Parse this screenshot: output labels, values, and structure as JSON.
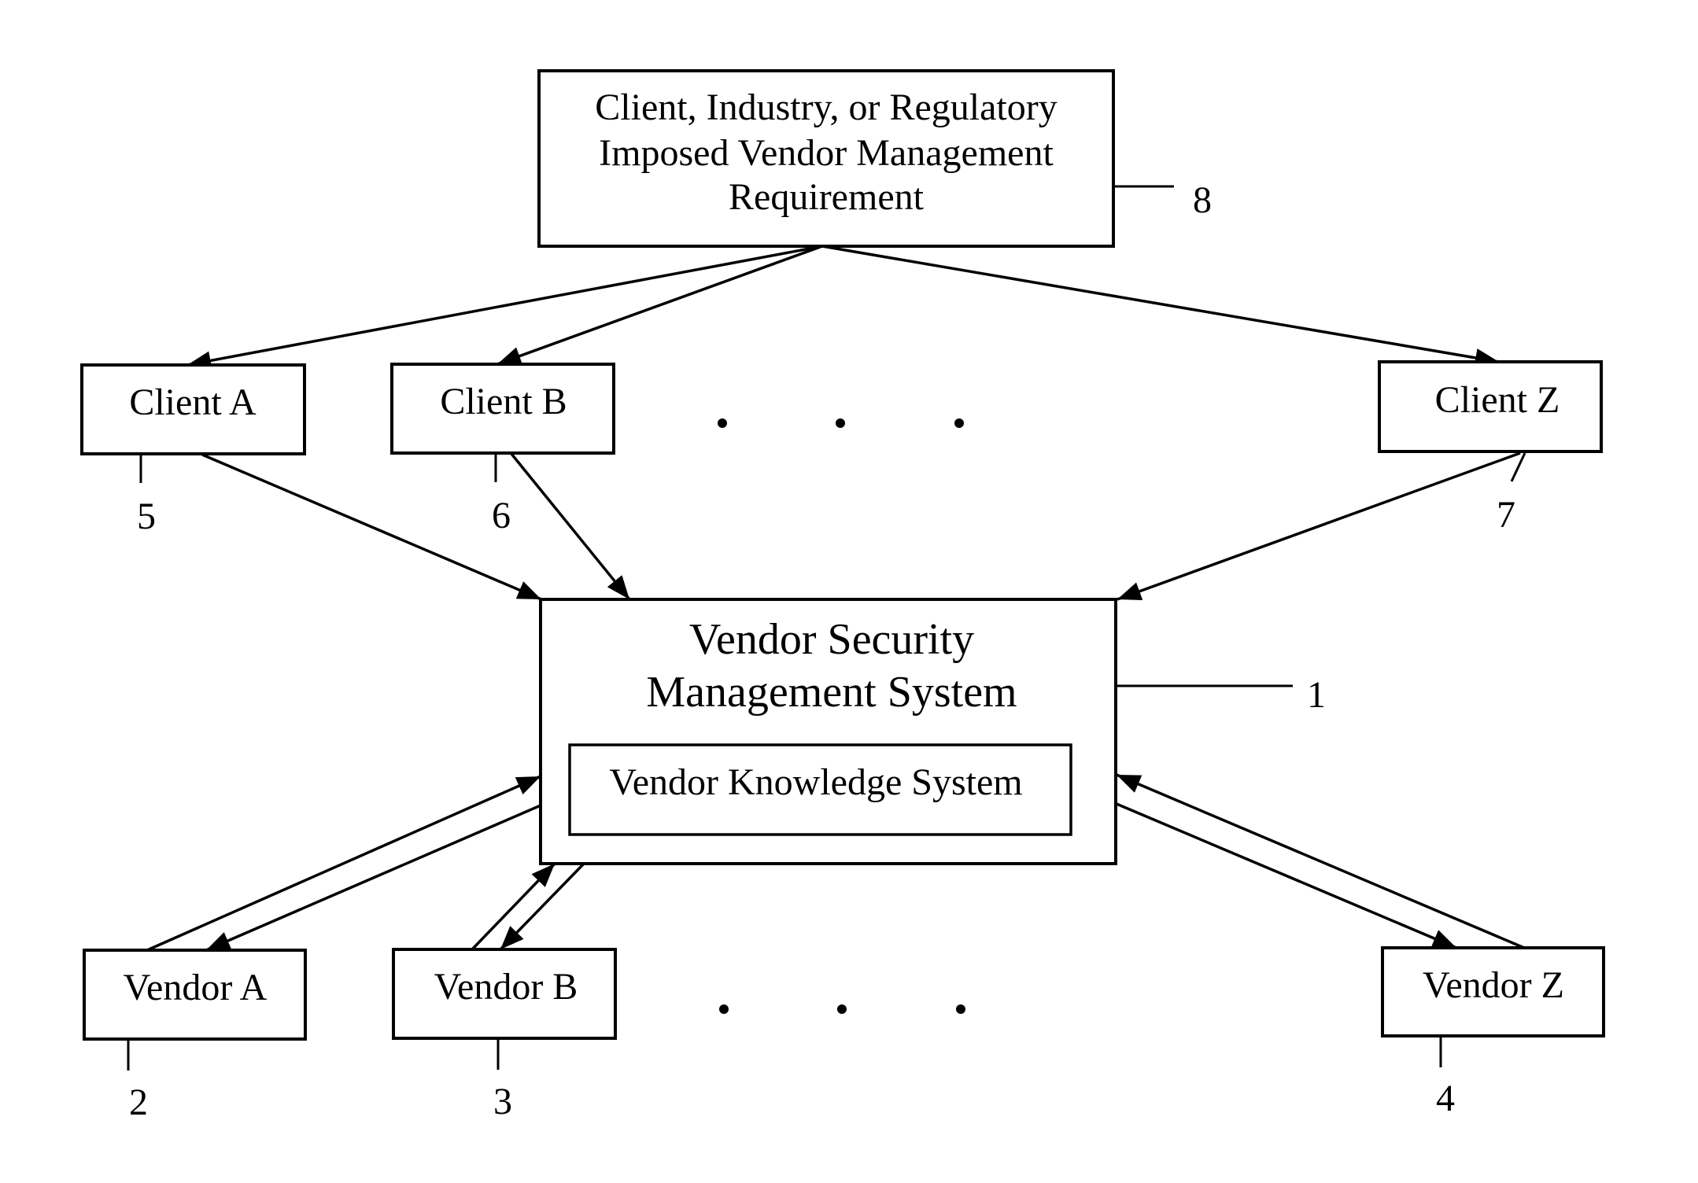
{
  "diagram": {
    "requirement": {
      "lines": [
        "Client, Industry, or Regulatory",
        "Imposed Vendor Management",
        "Requirement"
      ],
      "ref": "8"
    },
    "clients": [
      {
        "label": "Client A",
        "ref": "5"
      },
      {
        "label": "Client B",
        "ref": "6"
      },
      {
        "label": "Client Z",
        "ref": "7"
      }
    ],
    "system": {
      "lines": [
        "Vendor Security",
        "Management System"
      ],
      "ref": "1",
      "inner_label": "Vendor Knowledge System"
    },
    "vendors": [
      {
        "label": "Vendor A",
        "ref": "2"
      },
      {
        "label": "Vendor B",
        "ref": "3"
      },
      {
        "label": "Vendor Z",
        "ref": "4"
      }
    ],
    "ellipsis": "• • •",
    "connections": [
      {
        "from": "requirement",
        "to": "Client A",
        "direction": "one-way"
      },
      {
        "from": "requirement",
        "to": "Client B",
        "direction": "one-way"
      },
      {
        "from": "requirement",
        "to": "Client Z",
        "direction": "one-way"
      },
      {
        "from": "Client A",
        "to": "system",
        "direction": "one-way"
      },
      {
        "from": "Client B",
        "to": "system",
        "direction": "one-way"
      },
      {
        "from": "Client Z",
        "to": "system",
        "direction": "one-way"
      },
      {
        "from": "Vendor A",
        "to": "system",
        "direction": "two-way"
      },
      {
        "from": "Vendor B",
        "to": "system",
        "direction": "two-way"
      },
      {
        "from": "Vendor Z",
        "to": "system",
        "direction": "two-way"
      }
    ]
  }
}
